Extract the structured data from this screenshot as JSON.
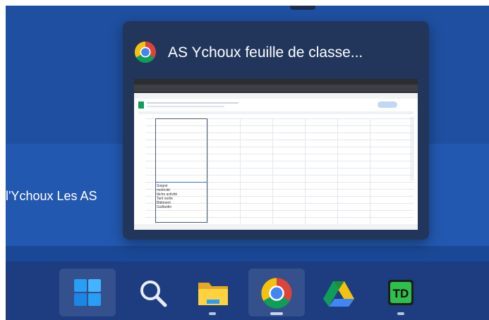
{
  "background_window": {
    "title_fragment": "l'Ychoux Les AS"
  },
  "preview": {
    "title": "AS Ychoux feuille de classe...",
    "app_icon": "chrome-icon"
  },
  "thumbnail": {
    "cells": [
      "Soigné",
      "motricité",
      "tâche activité",
      "Tant sortie",
      "Bâtiment",
      "Gaillardin"
    ]
  },
  "taskbar": {
    "items": [
      {
        "name": "start-button",
        "icon": "windows-logo-icon",
        "active": true,
        "running": false
      },
      {
        "name": "search-button",
        "icon": "search-icon",
        "active": false,
        "running": false
      },
      {
        "name": "file-explorer-button",
        "icon": "folder-icon",
        "active": false,
        "running": true
      },
      {
        "name": "chrome-button",
        "icon": "chrome-icon",
        "active": true,
        "running": true
      },
      {
        "name": "google-drive-button",
        "icon": "google-drive-icon",
        "active": false,
        "running": false
      },
      {
        "name": "td-app-button",
        "icon": "td-app-icon",
        "active": false,
        "running": true
      }
    ]
  },
  "colors": {
    "desktop": "#1f4fa0",
    "taskbar": "#1d3d80",
    "preview_bg": "#22365c",
    "chrome_red": "#db4437",
    "chrome_yellow": "#f4c20d",
    "chrome_green": "#0f9d58",
    "chrome_blue": "#4285f4"
  }
}
